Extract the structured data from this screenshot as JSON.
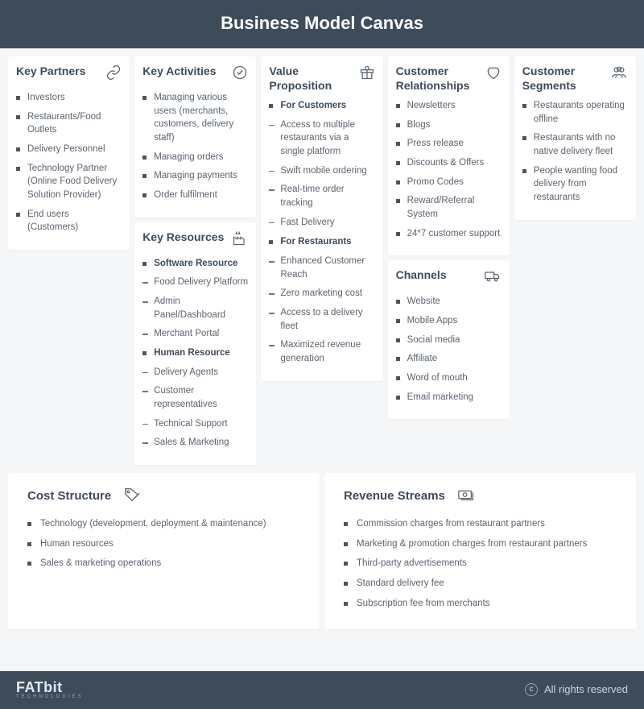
{
  "title": "Business Model Canvas",
  "cards": {
    "partners": {
      "title": "Key Partners",
      "items": [
        "Investors",
        "Restaurants/Food Outlets",
        "Delivery Personnel",
        "Technology Partner (Online Food Delivery Solution Provider)",
        "End users (Customers)"
      ]
    },
    "activities": {
      "title": "Key Activities",
      "items": [
        "Managing various users (merchants, customers, delivery staff)",
        "Managing orders",
        "Managing payments",
        "Order fulfilment"
      ]
    },
    "resources": {
      "title": "Key Resources",
      "section1_title": "Software Resource",
      "section1_items": [
        "Food Delivery Platform",
        "Admin Panel/Dashboard",
        "Merchant Portal"
      ],
      "section2_title": "Human Resource",
      "section2_items": [
        "Delivery Agents",
        "Customer representatives",
        "Technical Support",
        "Sales & Marketing"
      ]
    },
    "value": {
      "title": "Value Proposition",
      "section1_title": "For Customers",
      "section1_items": [
        "Access to multiple restaurants via a single platform",
        "Swift mobile ordering",
        "Real-time order tracking",
        "Fast Delivery"
      ],
      "section2_title": "For Restaurants",
      "section2_items": [
        "Enhanced Customer Reach",
        "Zero marketing cost",
        "Access to a delivery fleet",
        "Maximized revenue generation"
      ]
    },
    "relationships": {
      "title": "Customer Relationships",
      "items": [
        "Newsletters",
        "Blogs",
        "Press release",
        "Discounts & Offers",
        "Promo Codes",
        "Reward/Referral System",
        "24*7 customer support"
      ]
    },
    "channels": {
      "title": "Channels",
      "items": [
        "Website",
        "Mobile Apps",
        "Social media",
        "Affiliate",
        "Word of mouth",
        "Email marketing"
      ]
    },
    "segments": {
      "title": "Customer Segments",
      "items": [
        "Restaurants operating offline",
        "Restaurants with no native delivery fleet",
        "People wanting food delivery from restaurants"
      ]
    },
    "cost": {
      "title": "Cost Structure",
      "items": [
        "Technology (development, deployment & maintenance)",
        "Human resources",
        "Sales & marketing operations"
      ]
    },
    "revenue": {
      "title": "Revenue  Streams",
      "items": [
        "Commission charges from restaurant partners",
        "Marketing & promotion charges from restaurant partners",
        "Third-party advertisements",
        "Standard delivery fee",
        "Subscription fee from merchants"
      ]
    }
  },
  "footer": {
    "logo": "FATbit",
    "logo_sub": "TECHNOLOGIES",
    "copyright": "All rights reserved"
  }
}
